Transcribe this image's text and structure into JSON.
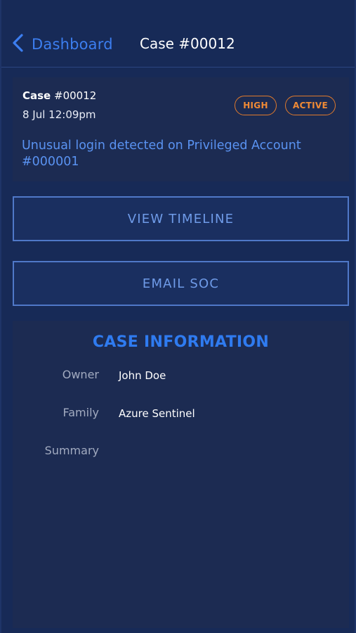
{
  "nav": {
    "back_label": "Dashboard",
    "title": "Case #00012"
  },
  "case": {
    "label_keyword": "Case",
    "label_number": "#00012",
    "datetime": "8 Jul 12:09pm",
    "badges": [
      "HIGH",
      "ACTIVE"
    ],
    "description": "Unusual login detected on Privileged Account #000001"
  },
  "actions": {
    "view_timeline": "VIEW TIMELINE",
    "email_soc": "EMAIL SOC"
  },
  "info": {
    "title": "CASE INFORMATION",
    "rows": [
      {
        "key": "Owner",
        "value": "John Doe"
      },
      {
        "key": "Family",
        "value": "Azure Sentinel"
      },
      {
        "key": "Summary",
        "value": ""
      }
    ]
  },
  "colors": {
    "background": "#172a57",
    "accent": "#3c7ef0",
    "badge": "#f08a35",
    "card": "#1c2b52"
  },
  "icons": {
    "back": "chevron-left-icon"
  }
}
